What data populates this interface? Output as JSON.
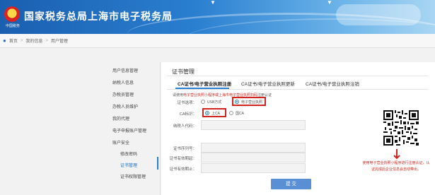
{
  "header": {
    "title": "国家税务总局上海市电子税务局",
    "emblem_caption": "中国税务",
    "banner_color": "#2a7fd0"
  },
  "breadcrumb": {
    "icon": "location-pin-icon",
    "items": [
      "首页",
      "我的信息",
      "用户管理"
    ],
    "separator": ">"
  },
  "menu": {
    "items": [
      {
        "label": "用户信息管理"
      },
      {
        "label": "纳税人信息"
      },
      {
        "label": "办税员管理"
      },
      {
        "label": "办税人员维护"
      },
      {
        "label": "我的代理"
      },
      {
        "label": "电子申报账户管理"
      },
      {
        "label": "账户安全"
      },
      {
        "label": "修改密码"
      },
      {
        "label": "证书管理"
      },
      {
        "label": "证书权限管理"
      }
    ],
    "active": "证书管理"
  },
  "main": {
    "section_title": "证书管理",
    "tabs": [
      {
        "label": "CA证书/电子营业执照注册"
      },
      {
        "label": "CA证书/电子营业执照更新"
      },
      {
        "label": "CA证书/电子营业执照注销"
      }
    ],
    "notice_prefix": "请使用",
    "notice_highlight": "电子营业执照小程序或上海市电子营业执照扫码",
    "notice_suffix": "注册认证",
    "form": {
      "cert_method_label": "证书选项：",
      "cert_method_options": [
        "USB方式",
        "电子营业执照"
      ],
      "cert_method_selected": "电子营业执照",
      "ca_label": "CA标识：",
      "ca_options": [
        "上CA",
        "国CA"
      ],
      "ca_selected": "上CA",
      "taxpayer_id_label": "纳税人代码：",
      "cert_serial_label": "证书序列号：",
      "valid_from_label": "证书有效期起：",
      "valid_to_label": "证书有效期止：",
      "submit_label": "提 交"
    }
  },
  "qr": {
    "caption": "使用电子营业执照小程序进行注册认证，认证完成后企业信息会自动带出。",
    "accent": "#d0261f"
  }
}
